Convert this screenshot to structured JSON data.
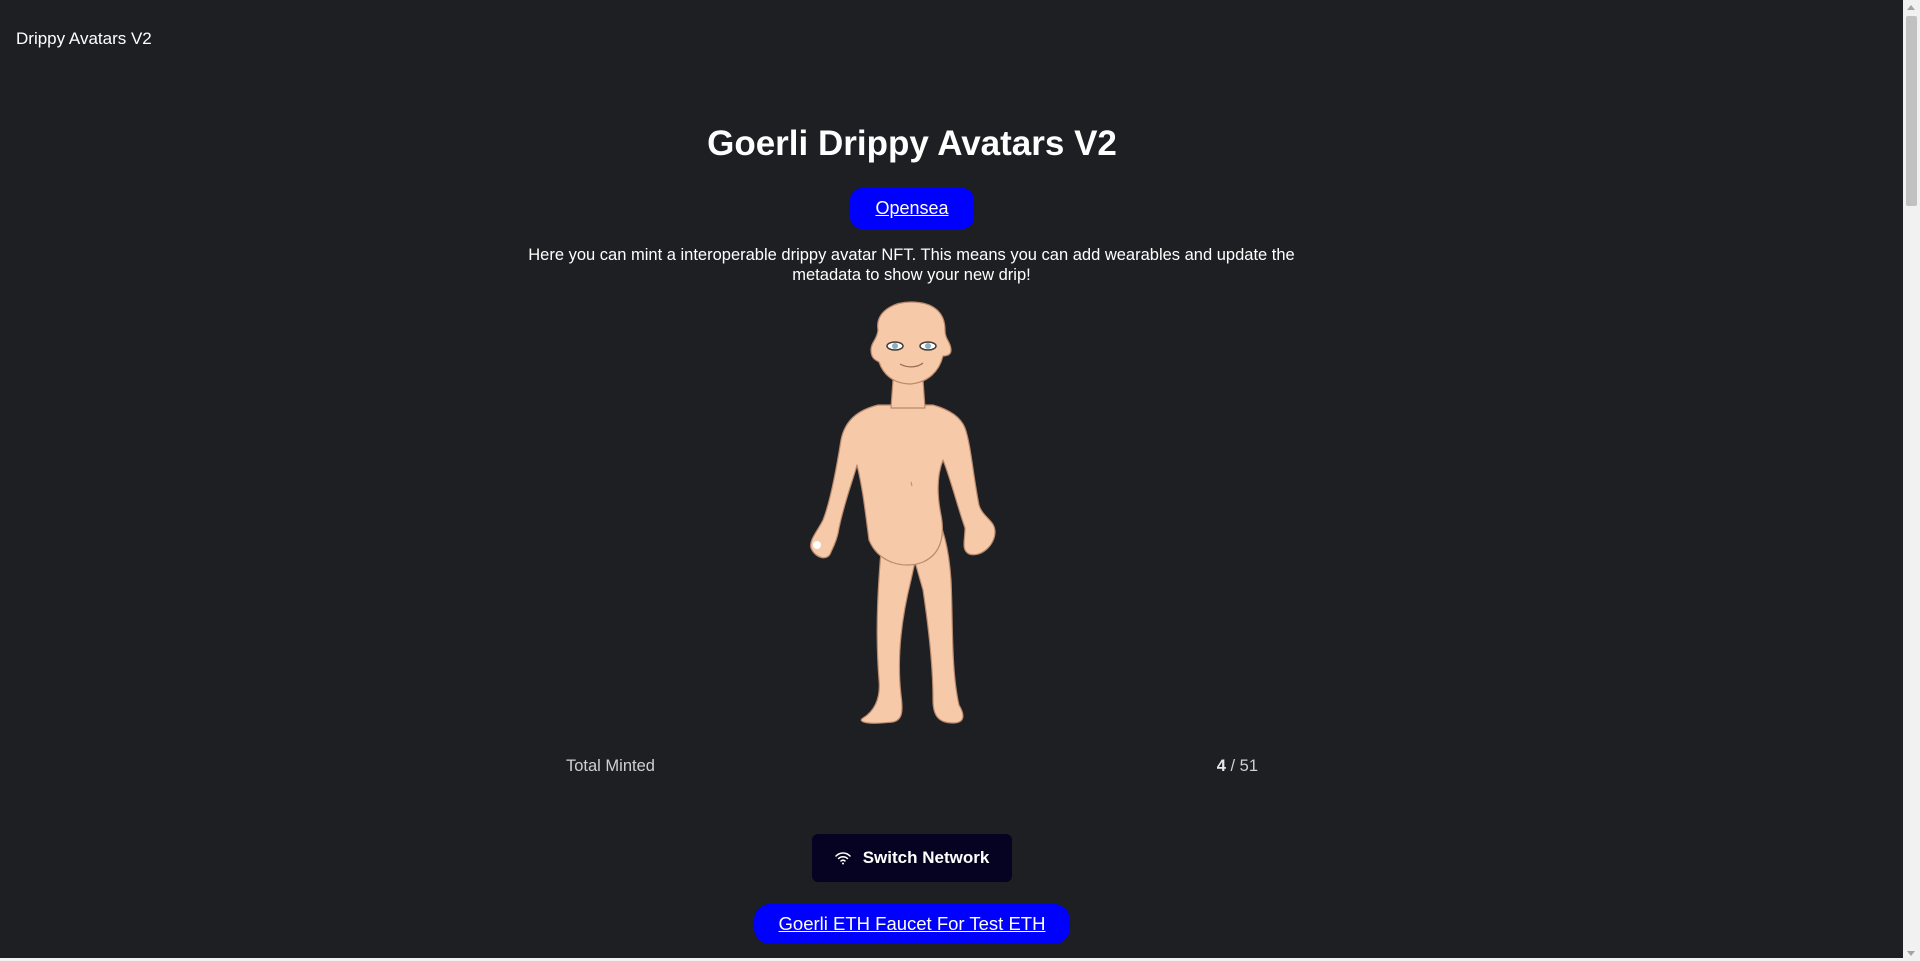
{
  "header": {
    "brand": "Drippy Avatars V2"
  },
  "main": {
    "title": "Goerli Drippy Avatars V2",
    "opensea_label": "Opensea",
    "description": "Here you can mint a interoperable drippy avatar NFT. This means you can add wearables and update the metadata to show your new drip!",
    "avatar_image": "nude-avatar-figure",
    "stats": {
      "label": "Total Minted",
      "minted": "4",
      "separator": " / ",
      "total": "51"
    },
    "switch_network_label": "Switch Network",
    "switch_network_icon": "wifi-icon",
    "faucet_label": "Goerli ETH Faucet For Test ETH"
  },
  "colors": {
    "background": "#1e1f22",
    "link_button": "#0000ff",
    "switch_button": "#060221",
    "skin": "#f6c9a8"
  }
}
